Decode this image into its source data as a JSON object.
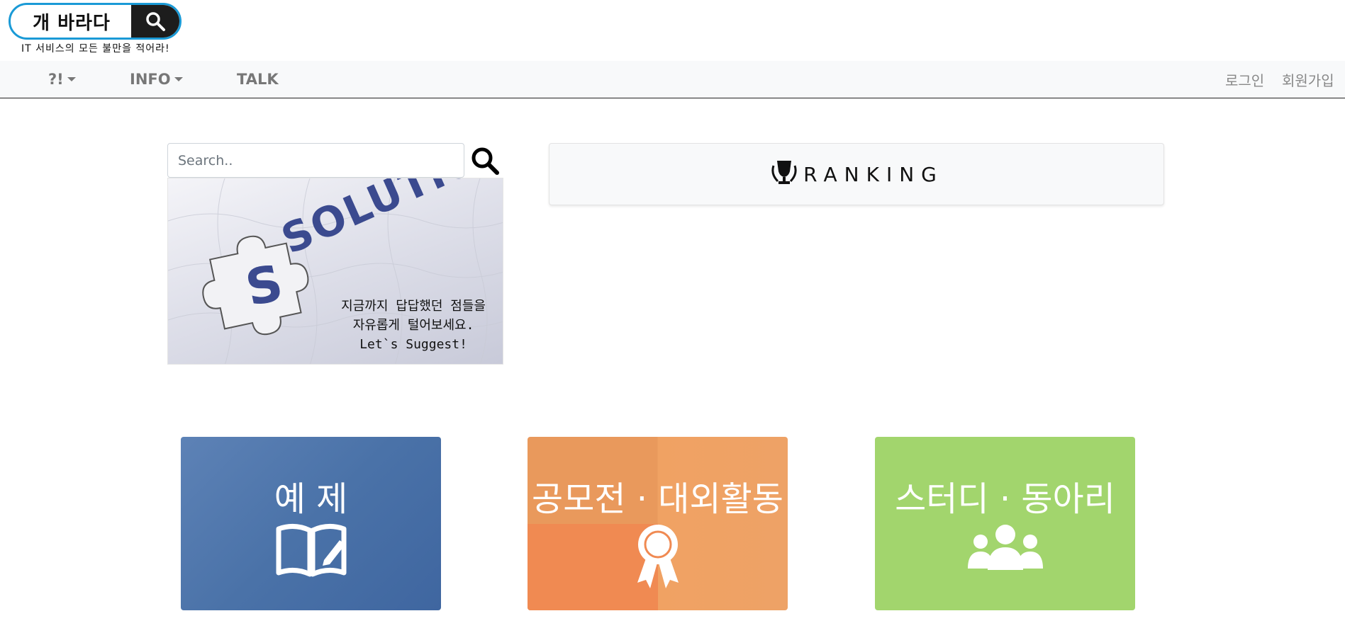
{
  "header": {
    "logo_text": "개 바라다",
    "tagline": "IT 서비스의 모든 불만을 적어라!"
  },
  "nav": {
    "items": [
      {
        "label": "?!",
        "dropdown": true
      },
      {
        "label": "INFO",
        "dropdown": true
      },
      {
        "label": "TALK",
        "dropdown": false
      }
    ],
    "login": "로그인",
    "signup": "회원가입"
  },
  "solution": {
    "search_placeholder": "Search..",
    "image_word": "SOLUTION",
    "image_lines": [
      "지금까지 답답했던 점들을",
      "자유롭게 털어보세요.",
      "Let`s Suggest!"
    ]
  },
  "ranking": {
    "label": "RANKING"
  },
  "tiles": [
    {
      "title": "예 제",
      "icon": "open-book-icon",
      "color": "#4a72a8"
    },
    {
      "title": "공모전 · 대외활동",
      "icon": "award-ribbon-icon",
      "color": "#e9995c"
    },
    {
      "title": "스터디 · 동아리",
      "icon": "people-group-icon",
      "color": "#a2d56d"
    }
  ]
}
